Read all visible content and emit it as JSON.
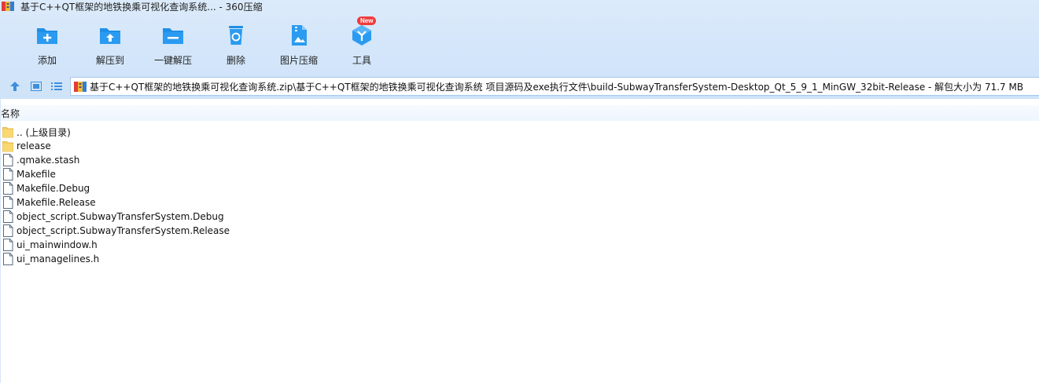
{
  "window": {
    "title": "基于C++QT框架的地铁换乘可视化查询系统... - 360压缩"
  },
  "toolbar": {
    "items": [
      {
        "label": "添加",
        "icon": "add-icon"
      },
      {
        "label": "解压到",
        "icon": "extract-to-icon"
      },
      {
        "label": "一键解压",
        "icon": "one-click-extract-icon"
      },
      {
        "label": "删除",
        "icon": "delete-icon"
      },
      {
        "label": "图片压缩",
        "icon": "image-compress-icon"
      },
      {
        "label": "工具",
        "icon": "tools-icon",
        "badge": "New"
      }
    ]
  },
  "nav": {
    "path": "基于C++QT框架的地铁换乘可视化查询系统.zip\\基于C++QT框架的地铁换乘可视化查询系统 项目源码及exe执行文件\\build-SubwayTransferSystem-Desktop_Qt_5_9_1_MinGW_32bit-Release - 解包大小为 71.7 MB"
  },
  "list": {
    "column_name": "名称",
    "rows": [
      {
        "name": ".. (上级目录)",
        "type": "folder"
      },
      {
        "name": "release",
        "type": "folder"
      },
      {
        "name": ".qmake.stash",
        "type": "file"
      },
      {
        "name": "Makefile",
        "type": "file"
      },
      {
        "name": "Makefile.Debug",
        "type": "file"
      },
      {
        "name": "Makefile.Release",
        "type": "file"
      },
      {
        "name": "object_script.SubwayTransferSystem.Debug",
        "type": "file"
      },
      {
        "name": "object_script.SubwayTransferSystem.Release",
        "type": "file"
      },
      {
        "name": "ui_mainwindow.h",
        "type": "file"
      },
      {
        "name": "ui_managelines.h",
        "type": "file"
      }
    ]
  },
  "colors": {
    "accent": "#1f8fe6",
    "folder": "#f7cf5e",
    "badge": "#f23a3a"
  }
}
